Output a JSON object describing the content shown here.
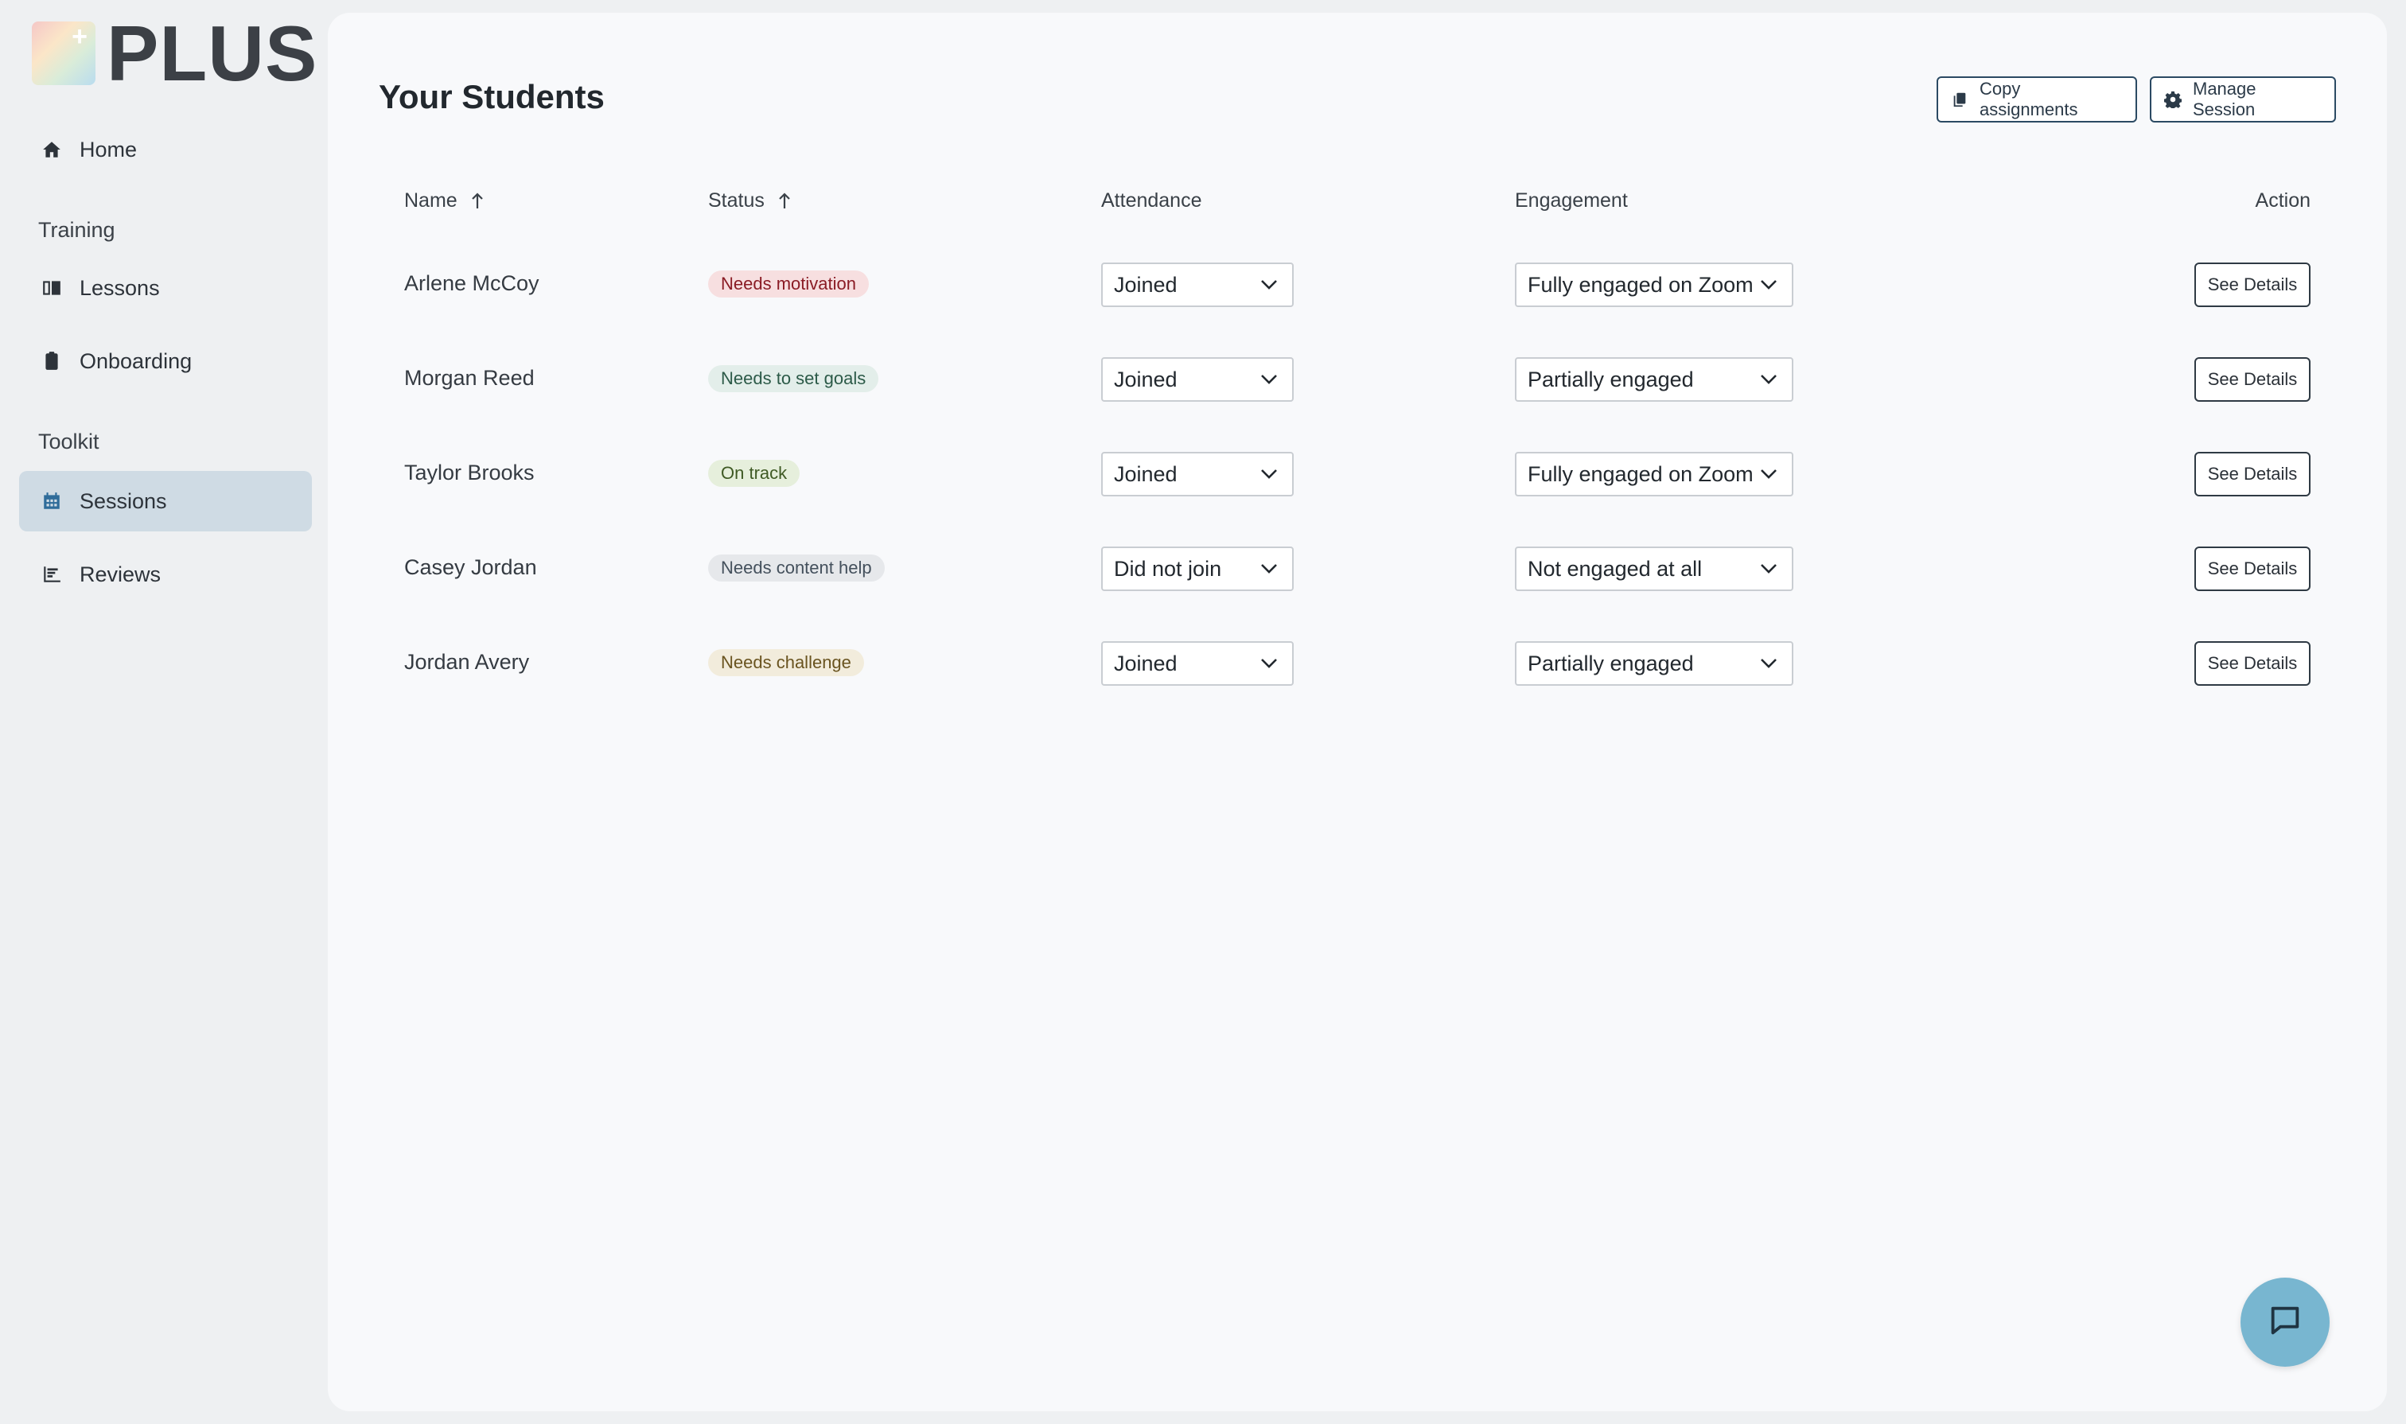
{
  "app": {
    "logo_text": "PLUS"
  },
  "sidebar": {
    "home": "Home",
    "section_training": "Training",
    "lessons": "Lessons",
    "onboarding": "Onboarding",
    "section_toolkit": "Toolkit",
    "sessions": "Sessions",
    "reviews": "Reviews"
  },
  "main": {
    "title": "Your Students",
    "copy_label": "Copy assignments",
    "manage_label": "Manage Session"
  },
  "table": {
    "headers": {
      "name": "Name",
      "status": "Status",
      "attendance": "Attendance",
      "engagement": "Engagement",
      "action": "Action"
    },
    "action_label": "See Details",
    "rows": [
      {
        "name": "Arlene McCoy",
        "status": "Needs motivation",
        "attendance": "Joined",
        "engagement": "Fully engaged on Zoom"
      },
      {
        "name": "Morgan Reed",
        "status": "Needs to set goals",
        "attendance": "Joined",
        "engagement": "Partially engaged"
      },
      {
        "name": "Taylor Brooks",
        "status": "On track",
        "attendance": "Joined",
        "engagement": "Fully engaged on Zoom"
      },
      {
        "name": "Casey Jordan",
        "status": "Needs content help",
        "attendance": "Did not join",
        "engagement": "Not engaged at all"
      },
      {
        "name": "Jordan Avery",
        "status": "Needs challenge",
        "attendance": "Joined",
        "engagement": "Partially engaged"
      }
    ]
  },
  "colors": {
    "accent": "#2f6c9a",
    "badge_motivation_bg": "#f7dfe0",
    "badge_motivation_fg": "#8a1c25",
    "badge_goals_bg": "#e3eeea",
    "badge_goals_fg": "#2c5a48",
    "badge_ontrack_bg": "#e6efdc",
    "badge_ontrack_fg": "#3f5a24",
    "badge_content_bg": "#e6e8eb",
    "badge_content_fg": "#44505c",
    "badge_challenge_bg": "#f2ecdc",
    "badge_challenge_fg": "#6a5420",
    "chat_fab": "#78b6d0"
  }
}
